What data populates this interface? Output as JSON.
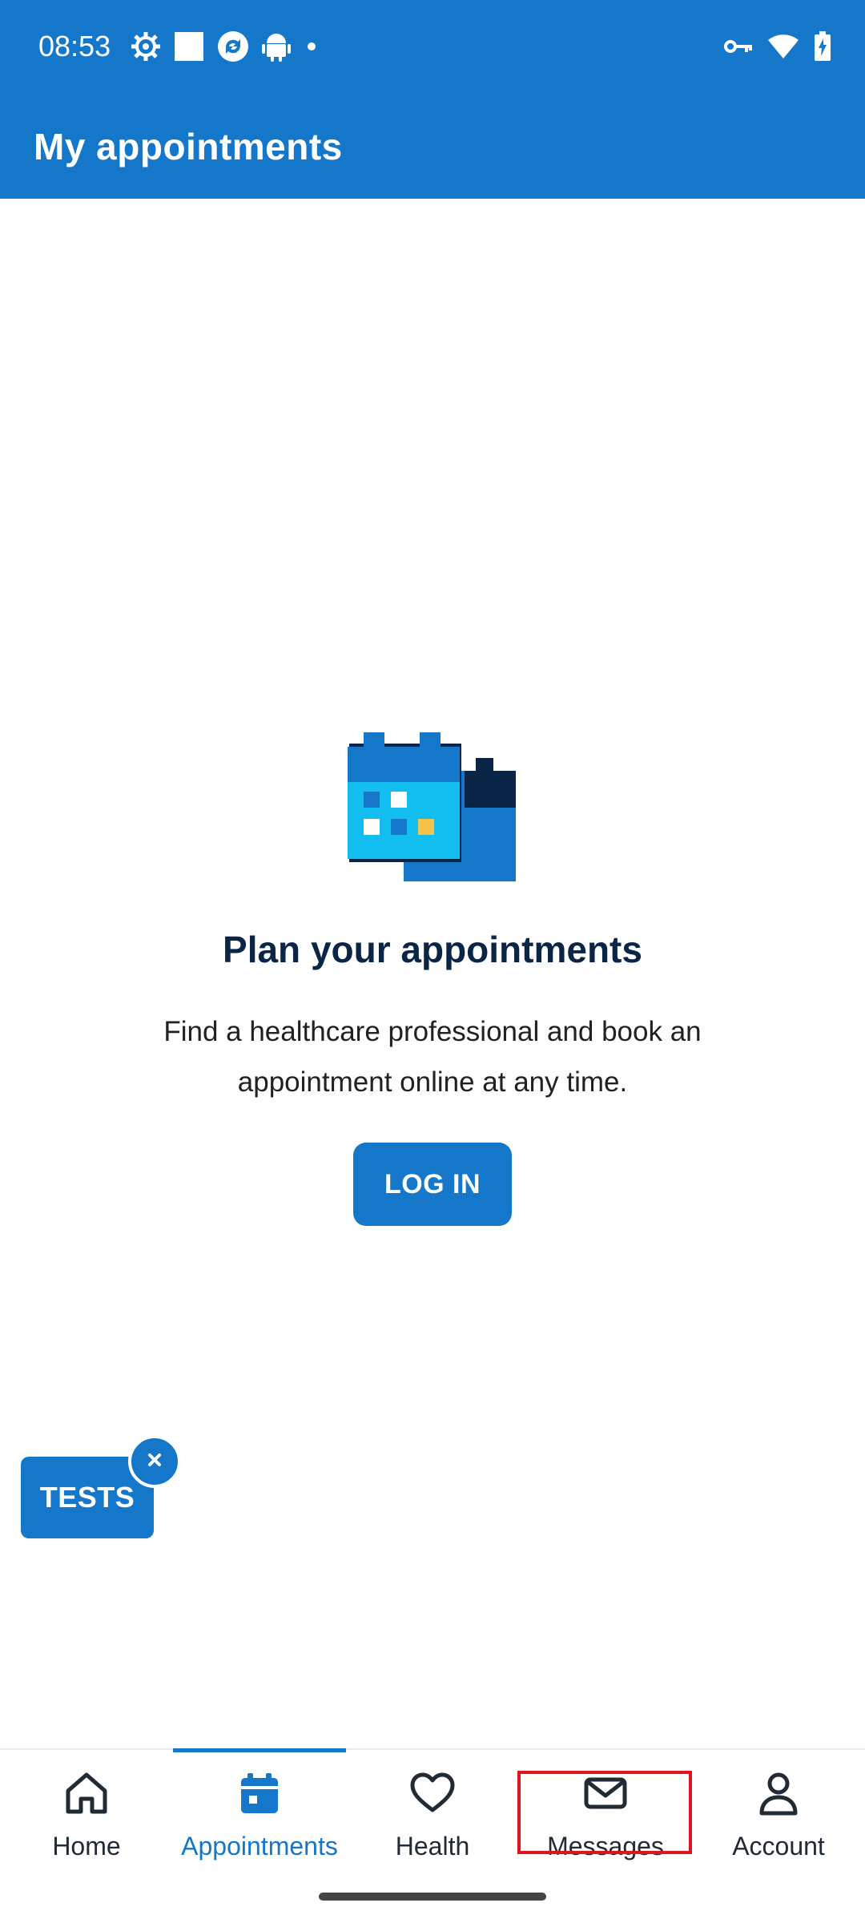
{
  "status_bar": {
    "time": "08:53",
    "left_icons": [
      "settings-gear-icon",
      "square-notification-icon",
      "sync-icon",
      "android-icon",
      "dot-icon"
    ],
    "right_icons": [
      "vpn-key-icon",
      "wifi-icon",
      "battery-charging-icon"
    ]
  },
  "header": {
    "title": "My appointments"
  },
  "empty_state": {
    "title": "Plan your appointments",
    "description": "Find a healthcare professional and book an appointment online at any time.",
    "login_label": "LOG IN"
  },
  "tests_badge": {
    "label": "TESTS",
    "close_glyph": "×"
  },
  "bottom_nav": {
    "items": [
      {
        "label": "Home",
        "icon": "home-icon"
      },
      {
        "label": "Appointments",
        "icon": "calendar-icon",
        "active": true
      },
      {
        "label": "Health",
        "icon": "heart-icon"
      },
      {
        "label": "Messages",
        "icon": "envelope-icon",
        "highlighted": true
      },
      {
        "label": "Account",
        "icon": "person-icon"
      }
    ]
  },
  "colors": {
    "primary": "#1477c9",
    "title_text": "#0b2546",
    "highlight_border": "#e0141e"
  }
}
